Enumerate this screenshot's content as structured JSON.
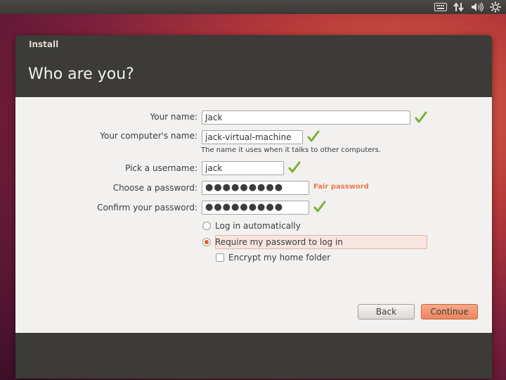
{
  "top_panel": {
    "indicators": [
      "keyboard-icon",
      "network-icon",
      "volume-icon",
      "settings-gear-icon"
    ]
  },
  "window": {
    "title": "Install",
    "page_title": "Who are you?"
  },
  "form": {
    "name_label": "Your name:",
    "name_value": "Jack",
    "computer_label": "Your computer's name:",
    "computer_value": "jack-virtual-machine",
    "computer_hint": "The name it uses when it talks to other computers.",
    "username_label": "Pick a username:",
    "username_value": "jack",
    "password_label": "Choose a password:",
    "password_value": "●●●●●●●●●",
    "password_strength": "Fair password",
    "confirm_label": "Confirm your password:",
    "confirm_value": "●●●●●●●●●",
    "login_auto_label": "Log in automatically",
    "require_password_label": "Require my password to log in",
    "encrypt_label": "Encrypt my home folder",
    "login_auto_selected": false,
    "require_password_selected": true,
    "encrypt_checked": false
  },
  "buttons": {
    "back": "Back",
    "continue": "Continue"
  },
  "colors": {
    "accent": "#e7582f",
    "check_green": "#7ab02c",
    "strength_orange": "#f07746",
    "header_bg": "#3c3b37",
    "content_bg": "#f2f1f0"
  }
}
